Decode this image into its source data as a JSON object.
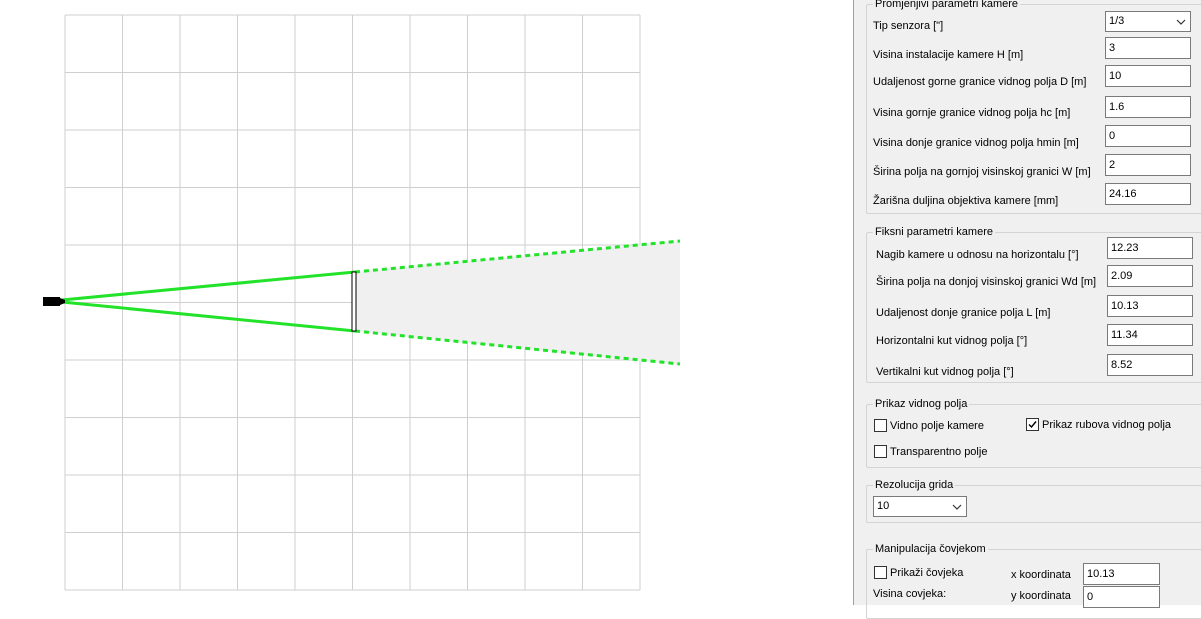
{
  "colors": {
    "grid_line": "#cfcfcf",
    "fov_edge": "#22e22a",
    "fov_fill": "#f0f0f0",
    "camera": "#000000",
    "panel_bg": "#f0f0f0"
  },
  "view": {
    "grid_divisions": 10,
    "camera_icon": "camera-icon"
  },
  "variable_params": {
    "title": "Promjenjivi parametri kamere",
    "sensor_type_label": "Tip senzora [\"]",
    "sensor_type_value": "1/3",
    "rows": [
      {
        "label": "Visina instalacije kamere H [m]",
        "value": "3"
      },
      {
        "label": "Udaljenost gorne granice vidnog polja D [m]",
        "value": "10"
      },
      {
        "label": "Visina gornje granice vidnog polja hc [m]",
        "value": "1.6"
      },
      {
        "label": "Visina donje granice vidnog polja hmin [m]",
        "value": "0"
      },
      {
        "label": "Širina polja na gornjoj visinskoj granici W [m]",
        "value": "2"
      },
      {
        "label": "Žarišna duljina objektiva kamere [mm]",
        "value": "24.16"
      }
    ]
  },
  "fixed_params": {
    "title": "Fiksni parametri kamere",
    "rows": [
      {
        "label": "Nagib kamere u odnosu na horizontalu [°]",
        "value": "12.23"
      },
      {
        "label": "Širina polja na donjoj visinskoj granici Wd [m]",
        "value": "2.09"
      },
      {
        "label": "Udaljenost donje granice polja L [m]",
        "value": "10.13"
      },
      {
        "label": "Horizontalni kut vidnog polja [°]",
        "value": "11.34"
      },
      {
        "label": "Vertikalni kut vidnog polja [°]",
        "value": "8.52"
      }
    ]
  },
  "fov_display": {
    "title": "Prikaz vidnog polja",
    "camera_fov_label": "Vidno polje kamere",
    "camera_fov_checked": false,
    "edges_label": "Prikaz rubova vidnog polja",
    "edges_checked": true,
    "transparent_label": "Transparentno polje",
    "transparent_checked": false
  },
  "grid_resolution": {
    "title": "Rezolucija grida",
    "value": "10"
  },
  "person": {
    "title": "Manipulacija čovjekom",
    "show_label": "Prikaži čovjeka",
    "show_checked": false,
    "height_label": "Visina covjeka:",
    "x_label": "x koordinata",
    "x_value": "10.13",
    "y_label": "y koordinata",
    "y_value": "0"
  }
}
